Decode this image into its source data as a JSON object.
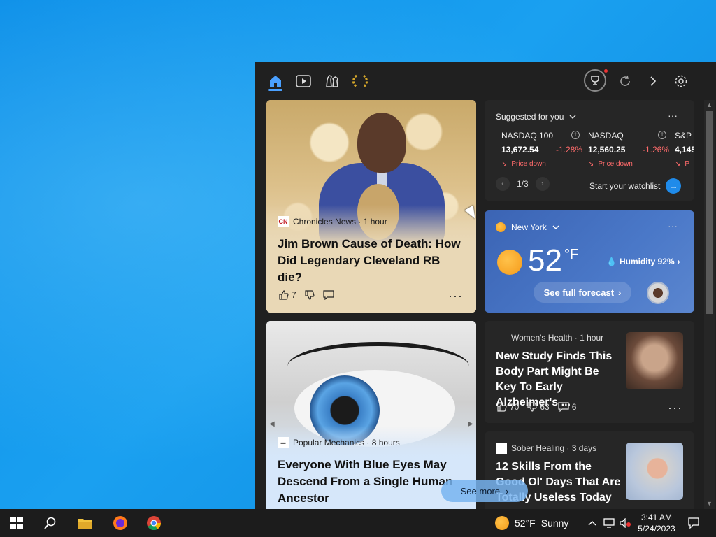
{
  "toolbar": {
    "icons": [
      "home-icon",
      "video-icon",
      "chess-icon",
      "laurel-icon",
      "rewards-icon",
      "refresh-icon",
      "chevron-right-icon",
      "settings-icon"
    ]
  },
  "card1": {
    "source": "Chronicles News · 1 hour",
    "source_logo": "CN",
    "headline": "Jim Brown Cause of Death: How Did Legendary Cleveland RB die?",
    "likes": "7",
    "more": "···"
  },
  "card2": {
    "source": "Popular Mechanics · 8 hours",
    "headline": "Everyone With Blue Eyes May Descend From a Single Human Ancestor"
  },
  "stocks": {
    "title": "Suggested for you",
    "more": "···",
    "quotes": [
      {
        "name": "NASDAQ 100",
        "value": "13,672.54",
        "change": "-1.28%",
        "status": "Price down"
      },
      {
        "name": "NASDAQ",
        "value": "12,560.25",
        "change": "-1.26%",
        "status": "Price down"
      },
      {
        "name": "S&P",
        "value": "4,145",
        "change": "",
        "status": "P"
      }
    ],
    "page": "1/3",
    "watchlist": "Start your watchlist"
  },
  "weather": {
    "location": "New York",
    "more": "···",
    "temp": "52",
    "unit": "°F",
    "humidity": "Humidity 92%",
    "forecast": "See full forecast"
  },
  "news1": {
    "source": "Women's Health · 1 hour",
    "headline": "New Study Finds This Body Part Might Be Key To Early Alzheimer's ...",
    "likes": "70",
    "dislikes": "63",
    "comments": "6",
    "more": "···"
  },
  "news2": {
    "source": "Sober Healing · 3 days",
    "headline": "12 Skills From the Good Ol' Days That Are Totally Useless Today ..."
  },
  "see_more": "See more",
  "taskbar": {
    "weather_temp": "52°F",
    "weather_cond": "Sunny",
    "time": "3:41 AM",
    "date": "5/24/2023"
  },
  "colors": {
    "accent": "#4aa0ff",
    "down": "#ff6b6b",
    "panel": "#202020"
  }
}
